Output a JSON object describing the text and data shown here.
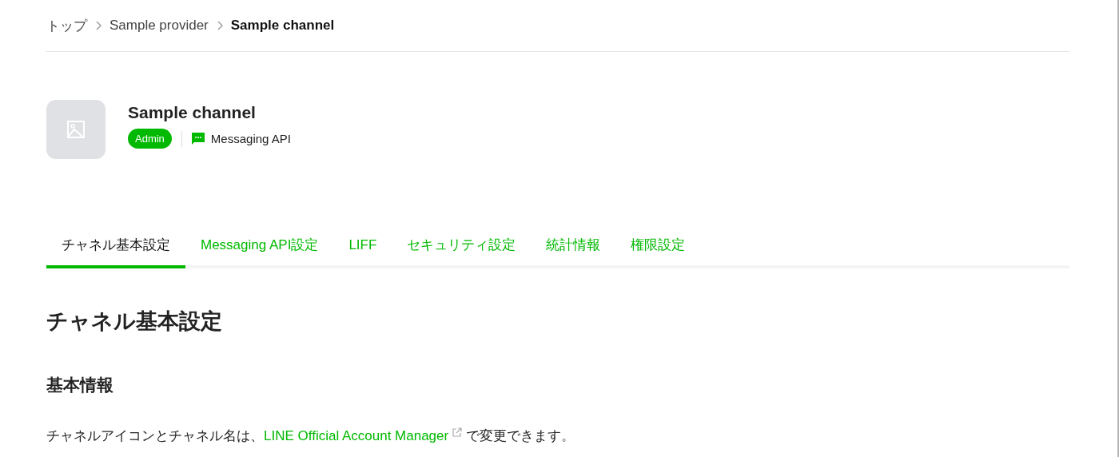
{
  "breadcrumb": [
    {
      "label": "トップ",
      "current": false
    },
    {
      "label": "Sample provider",
      "current": false
    },
    {
      "label": "Sample channel",
      "current": true
    }
  ],
  "channel": {
    "name": "Sample channel",
    "role": "Admin",
    "type": "Messaging API"
  },
  "tabs": [
    {
      "label": "チャネル基本設定",
      "selected": true
    },
    {
      "label": "Messaging API設定",
      "selected": false
    },
    {
      "label": "LIFF",
      "selected": false
    },
    {
      "label": "セキュリティ設定",
      "selected": false
    },
    {
      "label": "統計情報",
      "selected": false
    },
    {
      "label": "権限設定",
      "selected": false
    }
  ],
  "page_title": "チャネル基本設定",
  "section_title": "基本情報",
  "description": {
    "before": "チャネルアイコンとチャネル名は、",
    "link": "LINE Official Account Manager",
    "after": "で変更できます。"
  }
}
